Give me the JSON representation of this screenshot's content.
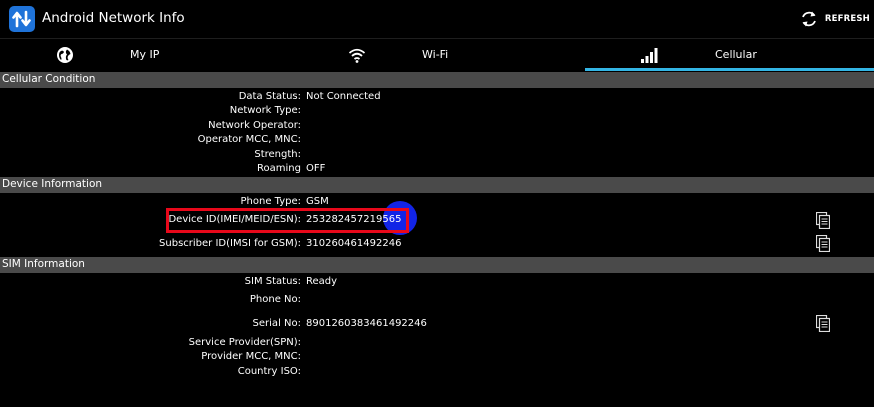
{
  "app": {
    "title": "Android Network Info",
    "refresh_label": "REFRESH"
  },
  "tabs": [
    {
      "label": "My IP",
      "icon": "globe-icon"
    },
    {
      "label": "Wi-Fi",
      "icon": "wifi-icon"
    },
    {
      "label": "Cellular",
      "icon": "signal-bars-icon",
      "selected": true
    }
  ],
  "colors": {
    "tab_indicator": "#33b5e5",
    "section_header": "#4a4a4a",
    "highlight": "#e8081a",
    "app_icon": "#1f73d9"
  },
  "sections": {
    "cellular": {
      "title": "Cellular Condition",
      "rows": [
        {
          "label": "Data Status:",
          "value": "Not Connected"
        },
        {
          "label": "Network Type:",
          "value": ""
        },
        {
          "label": "Network Operator:",
          "value": ""
        },
        {
          "label": "Operator MCC, MNC:",
          "value": ""
        },
        {
          "label": "Strength:",
          "value": ""
        },
        {
          "label": "Roaming",
          "value": "OFF"
        }
      ]
    },
    "device": {
      "title": "Device Information",
      "rows": [
        {
          "label": "Phone Type:",
          "value": "GSM"
        },
        {
          "label": "Device ID(IMEI/MEID/ESN):",
          "value": "253282457219565"
        },
        {
          "label": "Subscriber ID(IMSI for GSM):",
          "value": "310260461492246"
        }
      ]
    },
    "sim": {
      "title": "SIM Information",
      "rows": [
        {
          "label": "SIM Status:",
          "value": "Ready"
        },
        {
          "label": "Phone No:",
          "value": ""
        },
        {
          "label": "Serial No:",
          "value": "8901260383461492246"
        },
        {
          "label": "Service Provider(SPN):",
          "value": ""
        },
        {
          "label": "Provider MCC, MNC:",
          "value": ""
        },
        {
          "label": "Country ISO:",
          "value": ""
        }
      ]
    }
  }
}
